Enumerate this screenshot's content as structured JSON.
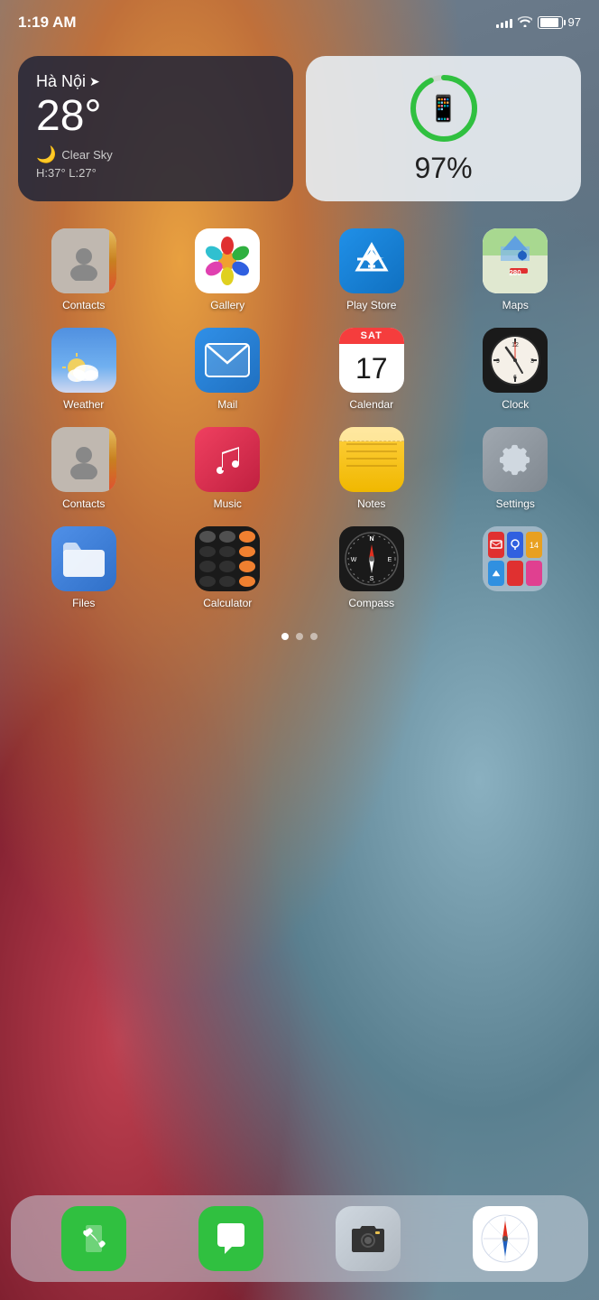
{
  "statusBar": {
    "time": "1:19 AM",
    "battery": "97"
  },
  "weatherWidget": {
    "city": "Hà Nội",
    "temperature": "28°",
    "condition": "Clear Sky",
    "high": "H:37°",
    "low": "L:27°"
  },
  "batteryWidget": {
    "percentage": "97%",
    "percent_num": 97
  },
  "apps": [
    {
      "id": "contacts",
      "label": "Contacts"
    },
    {
      "id": "gallery",
      "label": "Gallery"
    },
    {
      "id": "appstore",
      "label": "Play Store"
    },
    {
      "id": "maps",
      "label": "Maps"
    },
    {
      "id": "weather",
      "label": "Weather"
    },
    {
      "id": "mail",
      "label": "Mail"
    },
    {
      "id": "calendar",
      "label": "Calendar"
    },
    {
      "id": "clock",
      "label": "Clock"
    },
    {
      "id": "contacts2",
      "label": "Contacts"
    },
    {
      "id": "music",
      "label": "Music"
    },
    {
      "id": "notes",
      "label": "Notes"
    },
    {
      "id": "settings",
      "label": "Settings"
    },
    {
      "id": "files",
      "label": "Files"
    },
    {
      "id": "calculator",
      "label": "Calculator"
    },
    {
      "id": "compass",
      "label": "Compass"
    },
    {
      "id": "folder",
      "label": ""
    }
  ],
  "calendar": {
    "day": "SAT",
    "date": "17"
  },
  "pageDots": [
    {
      "active": true
    },
    {
      "active": false
    },
    {
      "active": false
    }
  ],
  "dock": {
    "phone_label": "Phone",
    "messages_label": "Messages",
    "camera_label": "Camera",
    "safari_label": "Safari"
  }
}
